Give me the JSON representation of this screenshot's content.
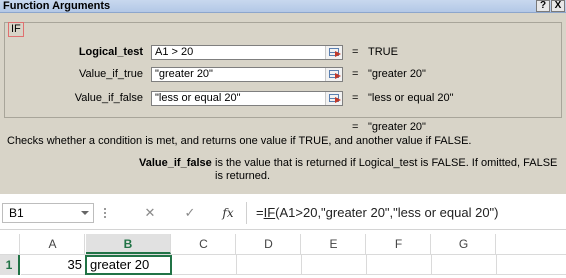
{
  "dialog": {
    "title": "Function Arguments",
    "help_button": "?",
    "close_button": "X",
    "function_name": "IF",
    "args": [
      {
        "label": "Logical_test",
        "value": "A1 > 20",
        "result": "TRUE"
      },
      {
        "label": "Value_if_true",
        "value": "\"greater 20\"",
        "result": "\"greater 20\""
      },
      {
        "label": "Value_if_false",
        "value": "\"less or equal 20\"",
        "result": "\"less or equal 20\""
      }
    ],
    "equals_sign": "=",
    "formula_result": "\"greater 20\"",
    "description": "Checks whether a condition is met, and returns one value if TRUE, and another value if FALSE.",
    "help_arg_name": "Value_if_false",
    "help_arg_text": "is the value that is returned if Logical_test is FALSE. If omitted, FALSE is returned."
  },
  "excel": {
    "name_box": "B1",
    "cancel_icon": "✕",
    "enter_icon": "✓",
    "fx_label": "fx",
    "formula_prefix": "=",
    "formula_fn": "IF",
    "formula_rest": "(A1>20,\"greater 20\",\"less or equal 20\")",
    "columns": [
      "A",
      "B",
      "C",
      "D",
      "E",
      "F",
      "G"
    ],
    "active_column": "B",
    "row_number": "1",
    "cells": {
      "A1": "35",
      "B1": "greater 20"
    }
  }
}
